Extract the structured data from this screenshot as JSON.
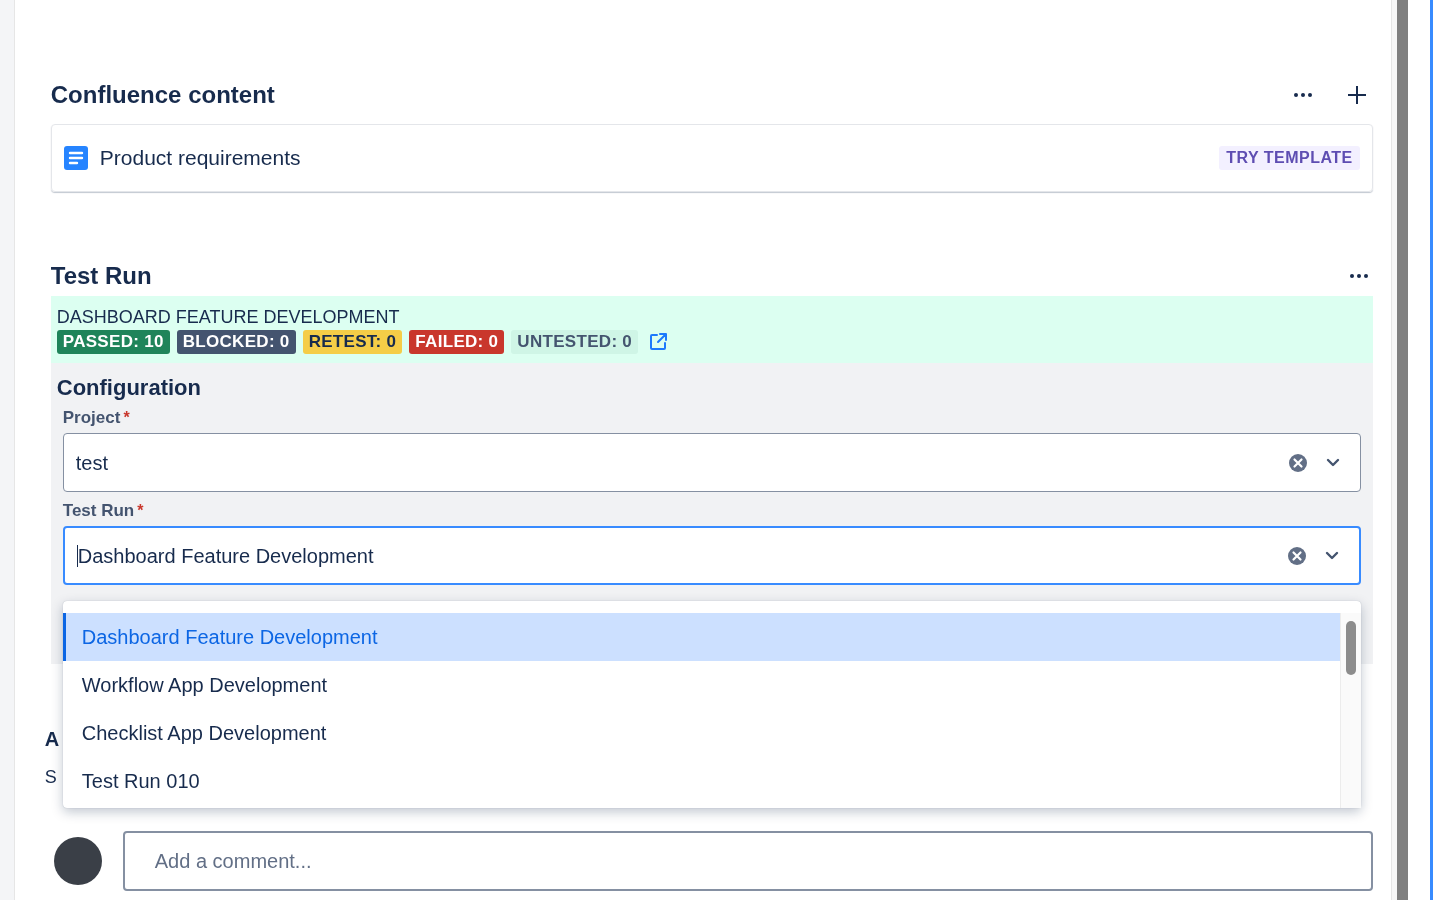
{
  "confluence": {
    "title": "Confluence content",
    "items": [
      {
        "title": "Product requirements",
        "action": "TRY TEMPLATE"
      }
    ]
  },
  "test_run": {
    "title": "Test Run",
    "run_name": "DASHBOARD FEATURE DEVELOPMENT",
    "stats": [
      {
        "label": "PASSED: 10",
        "color": "#1f845a"
      },
      {
        "label": "BLOCKED: 0",
        "color": "#44546f"
      },
      {
        "label": "RETEST: 0",
        "color": "#f5cd47"
      },
      {
        "label": "FAILED: 0",
        "color": "#c9372c"
      },
      {
        "label": "UNTESTED: 0",
        "color": "#cff5e6"
      }
    ],
    "configuration": {
      "title": "Configuration",
      "fields": [
        {
          "label": "Project",
          "required_mark": "*",
          "value": "test",
          "focused": false
        },
        {
          "label": "Test Run",
          "required_mark": "*",
          "value": "Dashboard Feature Development",
          "focused": true,
          "options": [
            {
              "label": "Dashboard Feature Development",
              "selected": true
            },
            {
              "label": "Workflow App Development",
              "selected": false
            },
            {
              "label": "Checklist App Development",
              "selected": false
            },
            {
              "label": "Test Run 010",
              "selected": false
            }
          ]
        }
      ]
    }
  },
  "activity": {
    "title": "A",
    "text": "S"
  },
  "comment": {
    "placeholder": "Add a comment..."
  }
}
